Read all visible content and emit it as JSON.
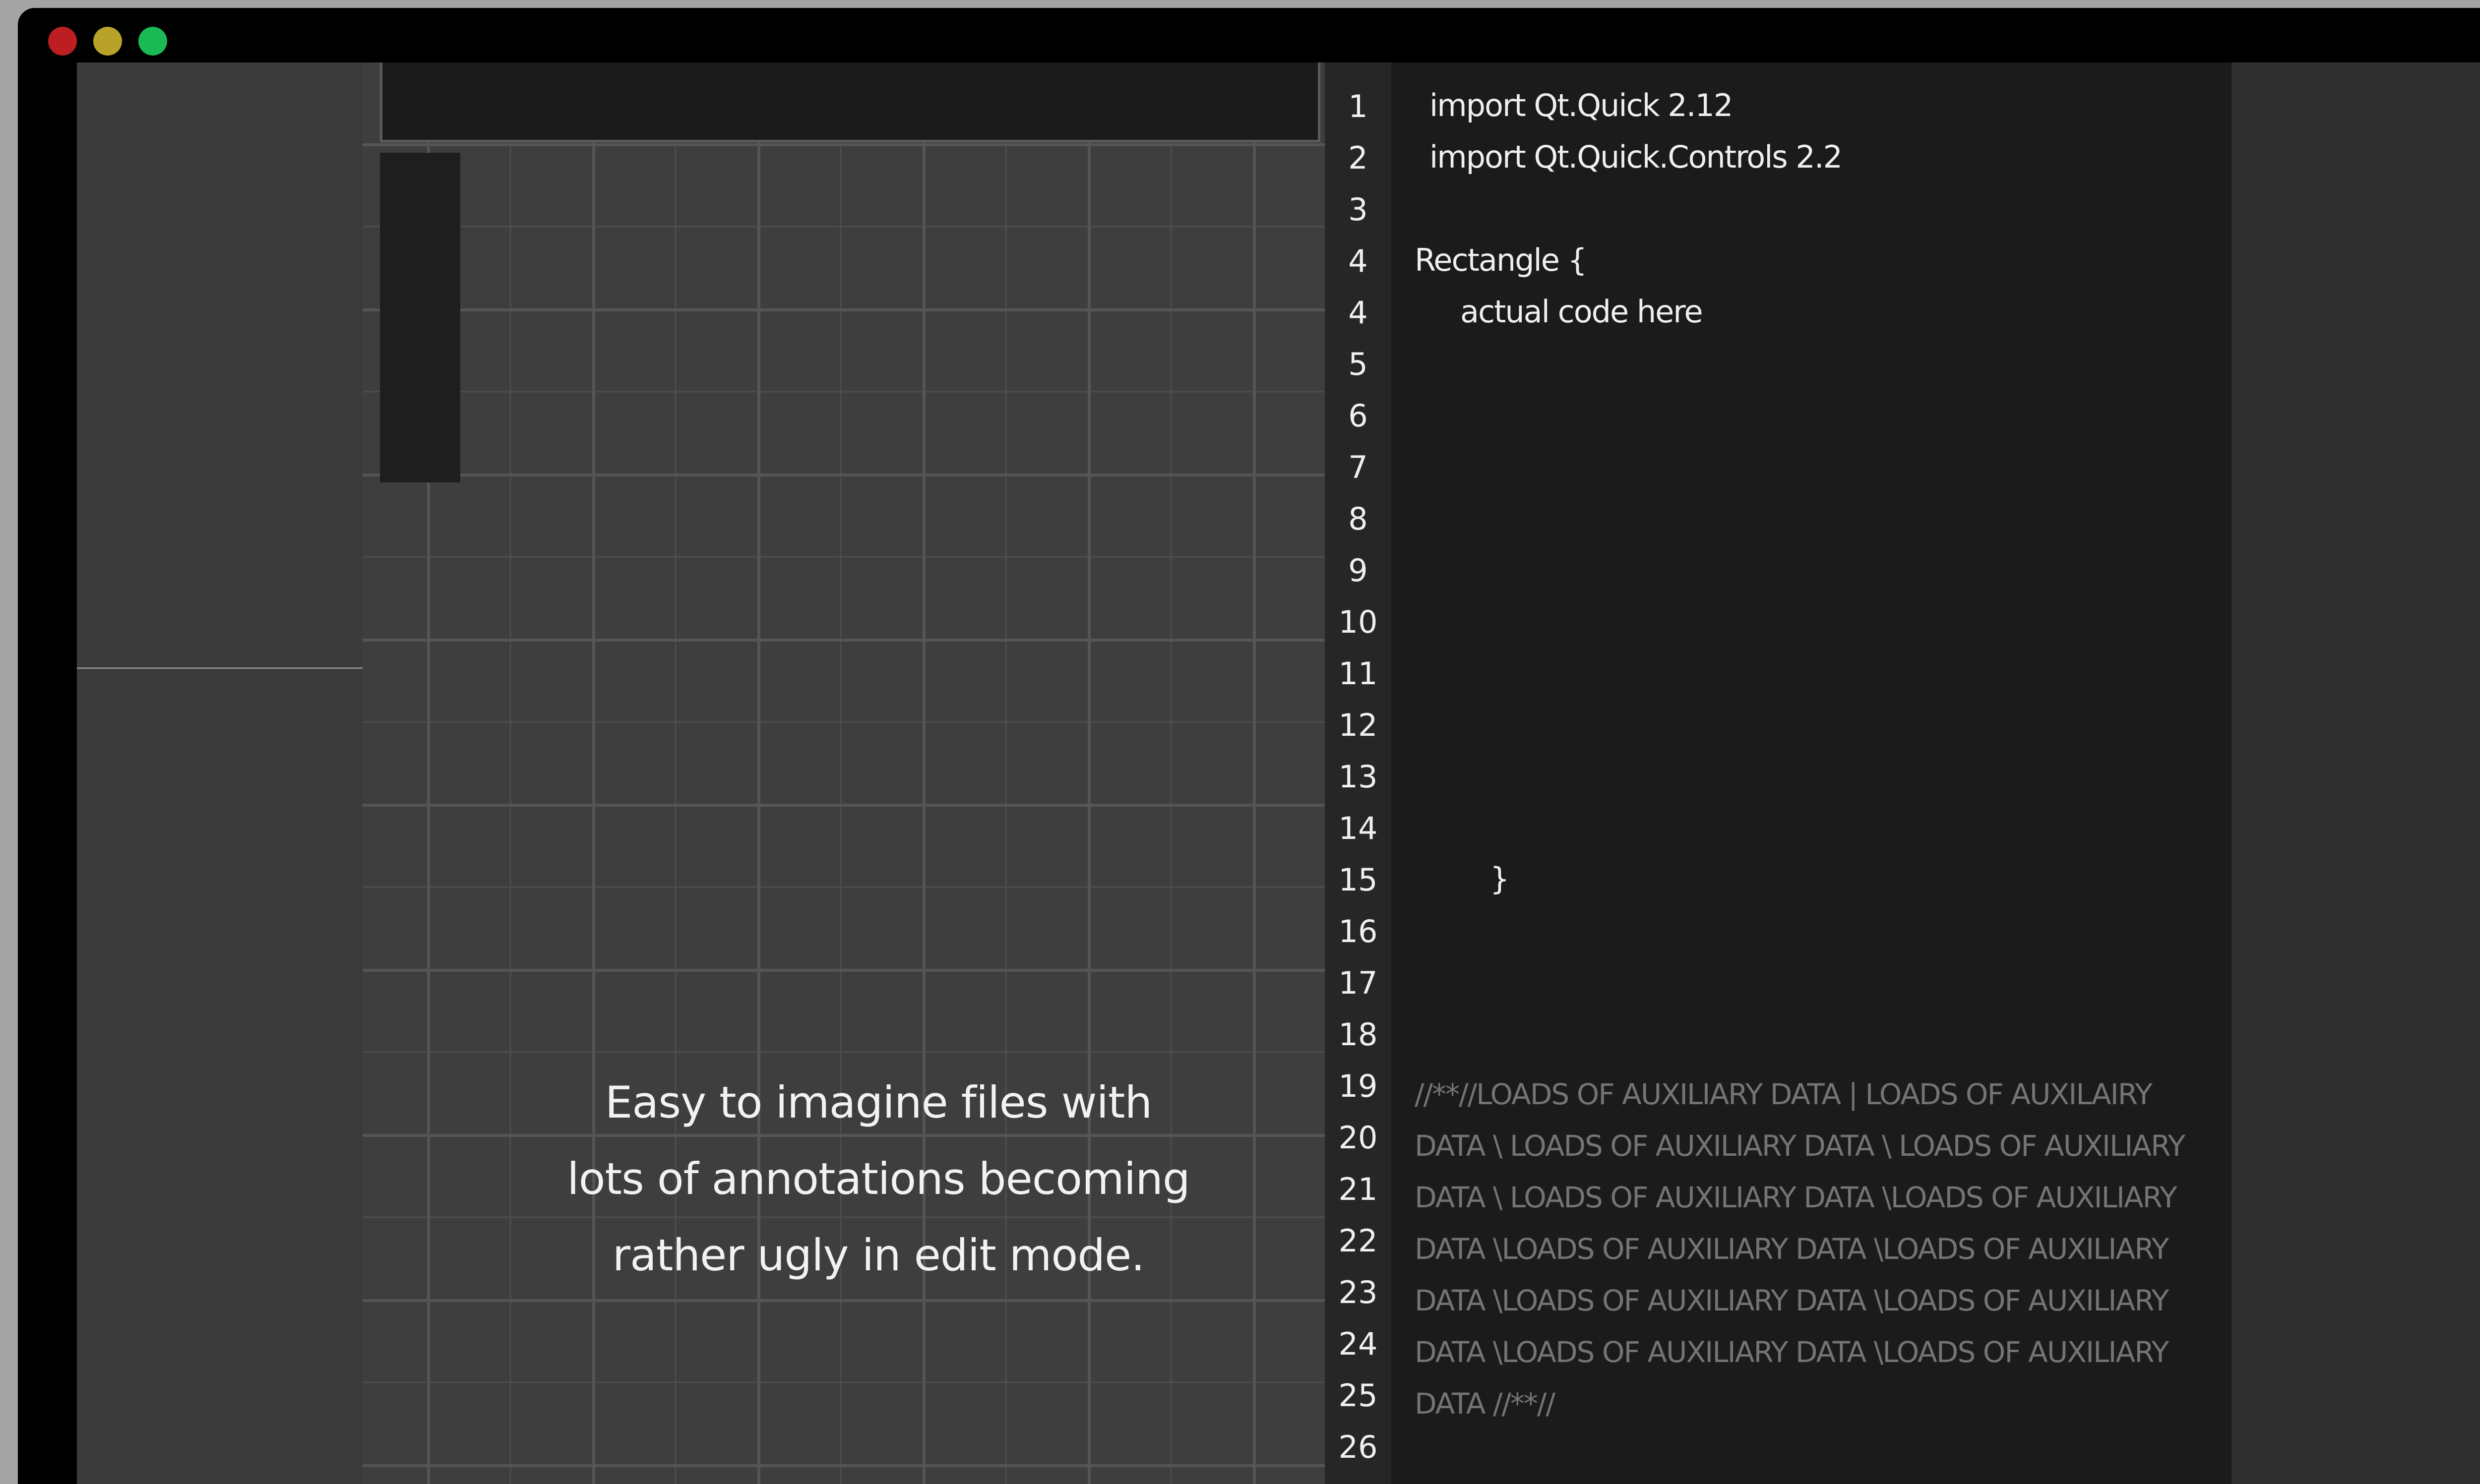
{
  "window": {
    "controls": [
      "close",
      "minimize",
      "maximize"
    ]
  },
  "canvas": {
    "note": "Easy to imagine files with lots of annotations becoming rather ugly in edit mode."
  },
  "editor": {
    "line_numbers": [
      "1",
      "2",
      "3",
      "4",
      "4",
      "5",
      "6",
      "7",
      "8",
      "9",
      "10",
      "11",
      "12",
      "13",
      "14",
      "15",
      "16",
      "17",
      "18",
      "19",
      "20",
      "21",
      "22",
      "23",
      "24",
      "25",
      "26"
    ],
    "code": {
      "import_quick": "import Qt.Quick 2.12",
      "import_controls": "import Qt.Quick.Controls 2.2",
      "rectangle_open": "Rectangle {",
      "body_placeholder": "actual code here",
      "closing_brace": "}"
    },
    "auxiliary_data": "//**//LOADS OF AUXILIARY DATA | LOADS OF AUXILAIRY DATA  \\ LOADS OF AUXILIARY DATA  \\ LOADS OF AUXILIARY DATA \\ LOADS OF AUXILIARY DATA  \\LOADS OF AUXILIARY DATA  \\LOADS OF AUXILIARY DATA  \\LOADS OF AUXILIARY DATA  \\LOADS OF AUXILIARY DATA  \\LOADS OF AUXILIARY DATA  \\LOADS OF AUXILIARY DATA  \\LOADS OF AUXILIARY DATA //**//"
  }
}
